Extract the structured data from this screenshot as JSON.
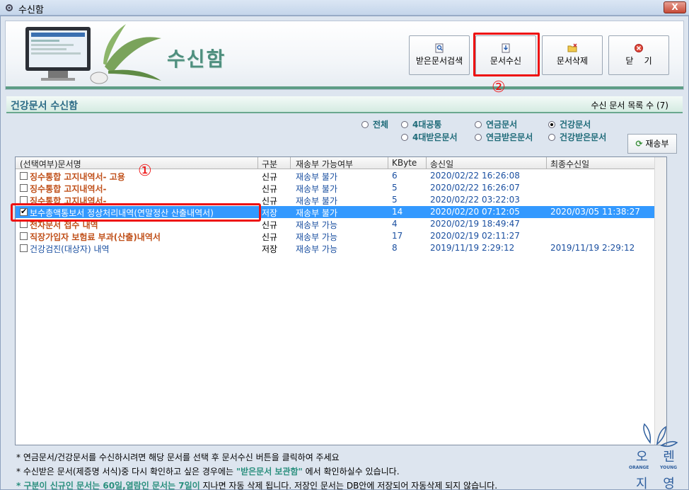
{
  "window": {
    "title": "수신함",
    "close_label": "X"
  },
  "header": {
    "heading": "수신함"
  },
  "toolbar": {
    "search_label": "받은문서검색",
    "receive_label": "문서수신",
    "delete_label": "문서삭제",
    "close_label": "닫    기"
  },
  "subbar": {
    "title": "건강문서 수신함",
    "count_text": "수신 문서 목록 수 (7)"
  },
  "filters": {
    "options": [
      "전체",
      "4대공통",
      "연금문서",
      "건강문서",
      "4대받은문서",
      "연금받은문서",
      "건강받은문서"
    ],
    "selected": "건강문서"
  },
  "resend_label": "재송부",
  "grid": {
    "columns": [
      "(선택여부)문서명",
      "구분",
      "재송부 가능여부",
      "KByte",
      "송신일",
      "최종수신일"
    ],
    "rows": [
      {
        "checked": false,
        "name": "징수통합 고지내역서- 고용",
        "type": "신규",
        "resend": "재송부 불가",
        "kb": "6",
        "sent": "2020/02/22 16:26:08",
        "last": ""
      },
      {
        "checked": false,
        "name": "징수통합 고지내역서-",
        "type": "신규",
        "resend": "재송부 불가",
        "kb": "5",
        "sent": "2020/02/22 16:26:07",
        "last": ""
      },
      {
        "checked": false,
        "name": "징수통합 고지내역서-",
        "type": "신규",
        "resend": "재송부 불가",
        "kb": "5",
        "sent": "2020/02/22 03:22:03",
        "last": ""
      },
      {
        "checked": true,
        "name": "보수총액통보서 정상처리내역(연말정산 산출내역서)",
        "type": "저장",
        "resend": "재송부 불가",
        "kb": "14",
        "sent": "2020/02/20 07:12:05",
        "last": "2020/03/05 11:38:27"
      },
      {
        "checked": false,
        "name": "전자문서 접수 내역",
        "type": "신규",
        "resend": "재송부 가능",
        "kb": "4",
        "sent": "2020/02/19 18:49:47",
        "last": ""
      },
      {
        "checked": false,
        "name": "직장가입자 보험료 부과(산출)내역서",
        "type": "신규",
        "resend": "재송부 가능",
        "kb": "17",
        "sent": "2020/02/19 02:11:27",
        "last": ""
      },
      {
        "checked": false,
        "name": "건강검진(대상자) 내역",
        "type": "저장",
        "resend": "재송부 가능",
        "kb": "8",
        "sent": "2019/11/19 2:29:12",
        "last": "2019/11/19 2:29:12"
      }
    ]
  },
  "markers": {
    "one": "①",
    "two": "②"
  },
  "notes": {
    "line1": "* 연금문서/건강문서를 수신하시려면 해당 문서를 선택 후 문서수신 버튼을 클릭하여 주세요",
    "line2_a": "* 수신받은 문서(제증명 서식)중 다시 확인하고 싶은 경우에는 ",
    "line2_b": "\"받은문서 보관함\"",
    "line2_c": " 에서 확인하실수 있습니다.",
    "line3_a": "* 구분이 신규인 문서는 60일,열람인 문서는 7일이",
    "line3_b": " 지나면 자동 삭제 됩니다. 저장인 문서는 DB안에 저장되어 자동삭제 되지 않습니다."
  },
  "watermark": {
    "top": "오 렌",
    "middle_left": "ORANGE",
    "middle_right": "YOUNG",
    "bottom": "지 영"
  },
  "colors": {
    "accent_green": "#4f8f7f",
    "selection_blue": "#3399ff",
    "highlight_red": "#ee1111"
  }
}
